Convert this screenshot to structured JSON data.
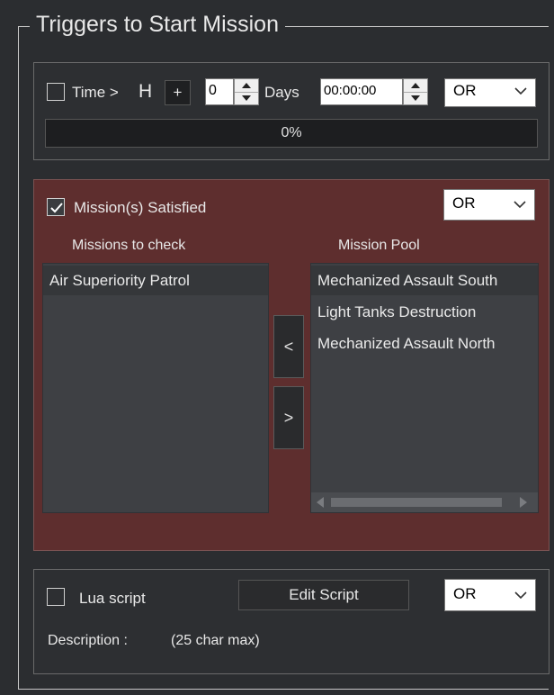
{
  "group_title": "Triggers to Start Mission",
  "time": {
    "checkbox_label": "Time >",
    "unit": "H",
    "plus_label": "+",
    "days_value": "0",
    "days_label": "Days",
    "time_value": "00:00:00",
    "operator": "OR",
    "checked": false
  },
  "progress": {
    "value": 0,
    "text": "0%"
  },
  "missions": {
    "checkbox_label": "Mission(s) Satisfied",
    "checked": true,
    "operator": "OR",
    "check_header": "Missions to check",
    "pool_header": "Mission Pool",
    "check_items": [
      "Air Superiority Patrol"
    ],
    "pool_items": [
      "Mechanized Assault South",
      "Light Tanks Destruction",
      "Mechanized Assault North"
    ],
    "add_label": "<",
    "remove_label": ">"
  },
  "lua": {
    "checkbox_label": "Lua script",
    "checked": false,
    "edit_label": "Edit Script",
    "operator": "OR",
    "description_label": "Description :",
    "description_hint": "(25 char max)"
  },
  "colors": {
    "background": "#2b2d30",
    "mission_panel": "#5e2e2e",
    "list_bg": "#3e4044"
  }
}
